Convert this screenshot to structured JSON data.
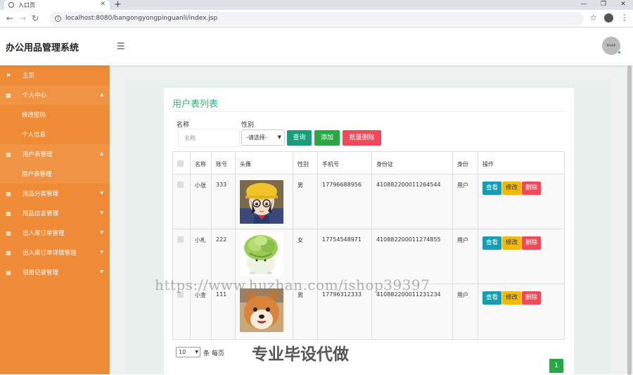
{
  "browser": {
    "tab_title": "入口页",
    "url": "localhost:8080/bangongyongpinguanli/index.jsp"
  },
  "header": {
    "app_title": "办公用品管理系统",
    "avatar_text": "80x80"
  },
  "sidebar": {
    "items": [
      {
        "label": "主页",
        "kind": "home"
      },
      {
        "label": "个人中心",
        "kind": "group",
        "expanded": true
      },
      {
        "label": "修改密码",
        "kind": "sub"
      },
      {
        "label": "个人信息",
        "kind": "sub"
      },
      {
        "label": "用户表管理",
        "kind": "group",
        "expanded": true
      },
      {
        "label": "用户表管理",
        "kind": "sub"
      },
      {
        "label": "用品分类管理",
        "kind": "item"
      },
      {
        "label": "用品信息管理",
        "kind": "item"
      },
      {
        "label": "出入库订单管理",
        "kind": "item"
      },
      {
        "label": "出入库订单详情管理",
        "kind": "item"
      },
      {
        "label": "领用记录管理",
        "kind": "item"
      }
    ]
  },
  "panel": {
    "title": "用户表列表",
    "search": {
      "name_label": "名称",
      "name_placeholder": "名称",
      "gender_label": "性别",
      "gender_selected": "-请选择-"
    },
    "buttons": {
      "query": "查询",
      "add": "添加",
      "batch_delete": "批量删除"
    },
    "table": {
      "headers": [
        "名称",
        "账号",
        "头像",
        "性别",
        "手机号",
        "身份证",
        "身份",
        "操作"
      ],
      "rows": [
        {
          "name": "小张",
          "account": "333",
          "gender": "男",
          "phone": "17796688956",
          "id_card": "410882200011264544",
          "role": "用户"
        },
        {
          "name": "小札",
          "account": "222",
          "gender": "女",
          "phone": "17754548971",
          "id_card": "410882200011274855",
          "role": "用户"
        },
        {
          "name": "小金",
          "account": "111",
          "gender": "男",
          "phone": "17796312333",
          "id_card": "410882200011231234",
          "role": "用户"
        }
      ],
      "ops": {
        "view": "查看",
        "edit": "修改",
        "delete": "删除"
      }
    },
    "footer": {
      "page_size": "10",
      "per_page_label": "条 每页",
      "current_page": "1"
    }
  },
  "overlay": {
    "watermark_url": "https://www.huzhan.com/ishop39397",
    "watermark_text": "专业毕设代做"
  },
  "colors": {
    "sidebar": "#ef8a36",
    "title_green": "#3bb07a",
    "query": "#1a9bb0",
    "add": "#28a745",
    "delete": "#f04a5a",
    "edit": "#f0b90b"
  }
}
